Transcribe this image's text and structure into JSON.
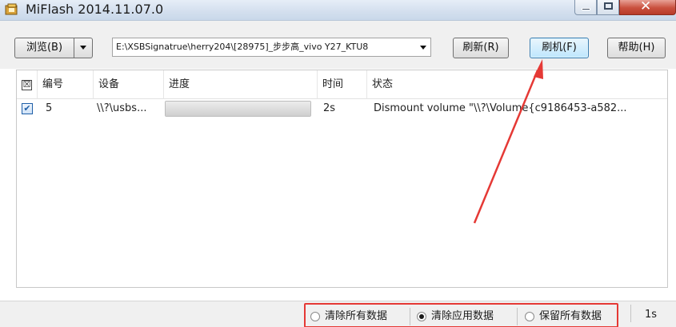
{
  "window": {
    "title": "MiFlash 2014.11.07.0",
    "icon": "miflash-app-icon"
  },
  "toolbar": {
    "browse_label": "浏览(B)",
    "path_value": "E:\\XSBSignatrue\\herry204\\[28975]_步步高_vivo Y27_KTU8",
    "refresh_label": "刷新(R)",
    "flash_label": "刷机(F)",
    "help_label": "帮助(H)"
  },
  "table": {
    "columns": [
      "编号",
      "设备",
      "进度",
      "时间",
      "状态"
    ],
    "header_check": "☒",
    "rows": [
      {
        "checked": true,
        "id": "5",
        "device": "\\\\?\\usbs...",
        "progress": 1.0,
        "time": "2s",
        "status": "Dismount volume \"\\\\?\\Volume{c9186453-a582..."
      }
    ]
  },
  "statusbar": {
    "options": [
      {
        "label": "清除所有数据",
        "selected": false
      },
      {
        "label": "清除应用数据",
        "selected": true
      },
      {
        "label": "保留所有数据",
        "selected": false
      }
    ],
    "elapsed": "1s"
  },
  "colors": {
    "annotation_red": "#e53935",
    "titlebar": "#d3dfee",
    "close_button": "#c9503e"
  }
}
